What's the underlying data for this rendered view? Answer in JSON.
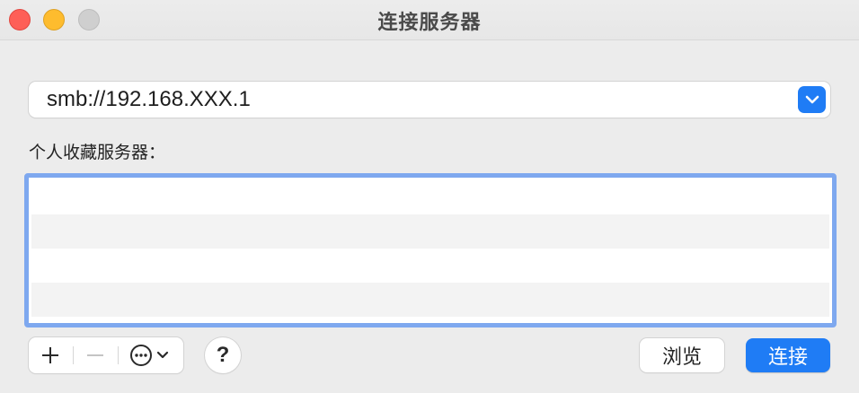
{
  "window": {
    "title": "连接服务器",
    "controls": {
      "close_color": "#fe5f57",
      "minimize_color": "#febc2e",
      "zoom_color": "#cfcfcf"
    }
  },
  "address": {
    "value": "smb://192.168.XXX.1",
    "dropdown_icon": "chevron-down-icon",
    "accent_color": "#1f7cf5"
  },
  "favorites": {
    "label": "个人收藏服务器：",
    "items": []
  },
  "toolbar": {
    "add_icon": "plus-icon",
    "remove_icon": "minus-icon",
    "more_icon": "ellipsis-circle-icon",
    "help_label": "?",
    "browse_label": "浏览",
    "connect_label": "连接"
  }
}
